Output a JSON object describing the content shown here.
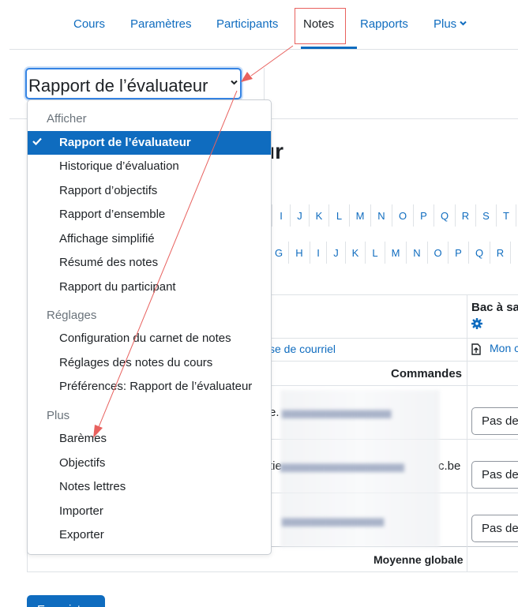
{
  "nav": {
    "items": [
      {
        "label": "Cours"
      },
      {
        "label": "Paramètres"
      },
      {
        "label": "Participants"
      },
      {
        "label": "Notes"
      },
      {
        "label": "Rapports"
      },
      {
        "label": "Plus"
      }
    ]
  },
  "selector": {
    "label": "Rapport de l’évaluateur"
  },
  "page": {
    "heading_fragment": "ur",
    "letters_row1": [
      "I",
      "J",
      "K",
      "L",
      "M",
      "N",
      "O",
      "P",
      "Q",
      "R",
      "S",
      "T"
    ],
    "letters_row2": [
      "G",
      "H",
      "I",
      "J",
      "K",
      "L",
      "M",
      "N",
      "O",
      "P",
      "Q",
      "R"
    ],
    "column_header": "Bac à sa",
    "email_header": "se de courriel",
    "link_partial": "Mon c",
    "commands_label": "Commandes",
    "rows": [
      {
        "email_prefix": "e.",
        "email_suffix": "",
        "grade": "Pas de"
      },
      {
        "email_prefix": "tie",
        "email_suffix": "c.be",
        "grade": "Pas de"
      },
      {
        "email_prefix": ".",
        "email_suffix": "",
        "grade": "Pas de"
      }
    ],
    "average_label": "Moyenne globale",
    "save_button": "Enregistrer"
  },
  "menu": {
    "sections": [
      {
        "header": "Afficher",
        "items": [
          {
            "label": "Rapport de l’évaluateur",
            "selected": true
          },
          {
            "label": "Historique d’évaluation"
          },
          {
            "label": "Rapport d’objectifs"
          },
          {
            "label": "Rapport d’ensemble"
          },
          {
            "label": "Affichage simplifié"
          },
          {
            "label": "Résumé des notes"
          },
          {
            "label": "Rapport du participant"
          }
        ]
      },
      {
        "header": "Réglages",
        "items": [
          {
            "label": "Configuration du carnet de notes"
          },
          {
            "label": "Réglages des notes du cours"
          },
          {
            "label": "Préférences: Rapport de l’évaluateur"
          }
        ]
      },
      {
        "header": "Plus",
        "items": [
          {
            "label": "Barèmes"
          },
          {
            "label": "Objectifs"
          },
          {
            "label": "Notes lettres"
          },
          {
            "label": "Importer"
          },
          {
            "label": "Exporter"
          }
        ]
      }
    ]
  },
  "colors": {
    "accent": "#0f6cbf",
    "annotation": "#e8615e",
    "focus": "#3584e4"
  }
}
